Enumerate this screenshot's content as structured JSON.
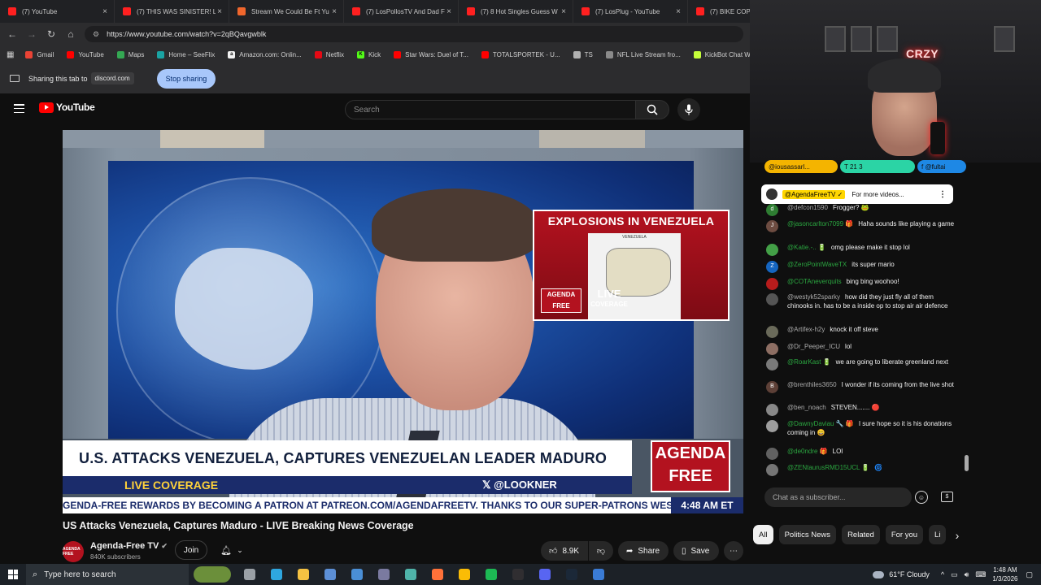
{
  "browser": {
    "tabs": [
      {
        "label": "(7) YouTube",
        "icon": "youtube-icon"
      },
      {
        "label": "(7) THIS WAS SINISTER! Lu",
        "icon": "youtube-icon"
      },
      {
        "label": "Stream We Could Be Ft Yu",
        "icon": "orange-site-icon"
      },
      {
        "label": "(7) LosPollosTV And Dad F",
        "icon": "youtube-icon"
      },
      {
        "label": "(7) 8 Hot Singles Guess W",
        "icon": "youtube-icon"
      },
      {
        "label": "(7) LosPlug - YouTube",
        "icon": "youtube-icon"
      },
      {
        "label": "(7) BIKE COPS",
        "icon": "youtube-icon"
      }
    ],
    "close_glyph": "×",
    "url": "https://www.youtube.com/watch?v=2qBQavgwblk",
    "bookmarks": [
      {
        "label": "Gmail",
        "color": "#ea4335",
        "glyph": ""
      },
      {
        "label": "YouTube",
        "color": "#ff0000",
        "glyph": ""
      },
      {
        "label": "Maps",
        "color": "#34a853",
        "glyph": ""
      },
      {
        "label": "Home – SeeFlix",
        "color": "#1aa3a3",
        "glyph": ""
      },
      {
        "label": "Amazon.com: Onlin...",
        "color": "#f2f2f2",
        "glyph": "a"
      },
      {
        "label": "Netflix",
        "color": "#e50914",
        "glyph": ""
      },
      {
        "label": "Kick",
        "color": "#53fc18",
        "glyph": "K"
      },
      {
        "label": "Star Wars: Duel of T...",
        "color": "#ff0000",
        "glyph": ""
      },
      {
        "label": "TOTALSPORTEK - U...",
        "color": "#ff0000",
        "glyph": ""
      },
      {
        "label": "TS",
        "color": "#b0b0b0",
        "glyph": ""
      },
      {
        "label": "NFL Live Stream fro...",
        "color": "#8a8a8a",
        "glyph": ""
      },
      {
        "label": "KickBot Chat Widget",
        "color": "#c6ff3a",
        "glyph": ""
      },
      {
        "label": "The be",
        "color": "#dddddd",
        "glyph": ""
      }
    ],
    "share_bar": {
      "text": "Sharing this tab to",
      "domain": "discord.com",
      "stop_label": "Stop sharing"
    }
  },
  "youtube": {
    "logo_text": "YouTube",
    "search_placeholder": "Search",
    "video": {
      "explosion_title": "EXPLOSIONS IN VENEZUELA",
      "map_title": "VENEZUELA",
      "mini_logo": "AGENDA FREE",
      "mini_live": "LIVE",
      "mini_coverage": "COVERAGE",
      "headline": "U.S. ATTACKS VENEZUELA, CAPTURES VENEZUELAN LEADER MADURO",
      "live_coverage": "LIVE COVERAGE",
      "handle": "𝕏 @LOOKNER",
      "logo_line1": "AGENDA",
      "logo_line2": "FREE",
      "ticker": "GENDA-FREE REWARDS BY BECOMING A PATRON AT PATREON.COM/AGENDAFREETV. THANKS TO OUR SUPER-PATRONS WESTON",
      "ticker_time": "4:48 AM ET"
    },
    "title": "US Attacks Venezuela, Captures Maduro - LIVE Breaking News Coverage",
    "channel": {
      "name": "Agenda-Free TV",
      "subs": "840K subscribers",
      "avatar_text": "AGENDA FREE"
    },
    "join_label": "Join",
    "likes": "8.9K",
    "share_label": "Share",
    "save_label": "Save"
  },
  "webcam": {
    "sign": "CRZY"
  },
  "chat": {
    "pins": [
      {
        "label": "@iousassarl...",
        "color": "#f4b400"
      },
      {
        "label": "T 21  3",
        "color": "#2bd4a5"
      },
      {
        "label": "f @fultai",
        "color": "#1e88e5"
      }
    ],
    "pinned": {
      "name": "@AgendaFreeTV ✓",
      "text": "For more videos..."
    },
    "messages": [
      {
        "user": "@defcon1590",
        "text": "Frogger? 🐸",
        "avatar": "d",
        "color": "#2e7d32",
        "member": false
      },
      {
        "user": "@jasoncarlton7099 🎁",
        "text": "Haha sounds like playing a game",
        "avatar": "J",
        "color": "#6d4c41",
        "member": true
      },
      {
        "user": "@Katie.-.. 🔋",
        "text": "omg please make it stop lol",
        "avatar": "",
        "color": "#43a047",
        "member": true
      },
      {
        "user": "@ZeroPointWaveTX",
        "text": "its super mario",
        "avatar": "Z",
        "color": "#1565c0",
        "member": true
      },
      {
        "user": "@COTAneverquits",
        "text": "bing bing woohoo!",
        "avatar": "",
        "color": "#b71c1c",
        "member": true
      },
      {
        "user": "@westyk52sparky",
        "text": "how did they just fly all of them chinooks in. has to be a inside op to stop air air defence",
        "avatar": "",
        "color": "#555555",
        "member": false
      },
      {
        "user": "@Artifex-h2y",
        "text": "knock it off steve",
        "avatar": "",
        "color": "#6a6a5a",
        "member": false
      },
      {
        "user": "@Dr_Peeper_ICU",
        "text": "lol",
        "avatar": "",
        "color": "#8d6e63",
        "member": false
      },
      {
        "user": "@RoarKast 🔋",
        "text": "we are going to liberate greenland next",
        "avatar": "",
        "color": "#7a7a7a",
        "member": true
      },
      {
        "user": "@brenthiles3650",
        "text": "I wonder if its coming from the live shot",
        "avatar": "B",
        "color": "#5d4037",
        "member": false
      },
      {
        "user": "@ben_noach",
        "text": "STEVEN....... 🔴",
        "avatar": "",
        "color": "#888888",
        "member": false
      },
      {
        "user": "@DawnyDaviau 🔧 🎁",
        "text": "I sure hope so it is his donations coming in 😀",
        "avatar": "",
        "color": "#9e9e9e",
        "member": true
      },
      {
        "user": "@de0ndre 🎁",
        "text": "LOl",
        "avatar": "",
        "color": "#616161",
        "member": true
      },
      {
        "user": "@ZENtaurusRMD15UCL 🔋",
        "text": "🌀",
        "avatar": "",
        "color": "#757575",
        "member": true
      }
    ],
    "input_placeholder": "Chat as a subscriber...",
    "chips": [
      "All",
      "Politics News",
      "Related",
      "For you",
      "Li"
    ]
  },
  "taskbar": {
    "search_text": "Type here to search",
    "apps": [
      {
        "name": "hamster-icon",
        "color": "#6b8f3a"
      },
      {
        "name": "task-view-icon",
        "color": "#9aa0a6"
      },
      {
        "name": "edge-icon",
        "color": "#2ea7e0"
      },
      {
        "name": "file-explorer-icon",
        "color": "#f5c242"
      },
      {
        "name": "app-icon-1",
        "color": "#5c8fd6"
      },
      {
        "name": "calculator-icon",
        "color": "#4a8fd6"
      },
      {
        "name": "app-icon-2",
        "color": "#7a7aa0"
      },
      {
        "name": "app-icon-3",
        "color": "#4fb3a9"
      },
      {
        "name": "firefox-icon",
        "color": "#ff7139"
      },
      {
        "name": "chrome-icon",
        "color": "#fbbc05"
      },
      {
        "name": "spotify-icon",
        "color": "#1db954"
      },
      {
        "name": "obs-icon",
        "color": "#302e31"
      },
      {
        "name": "discord-icon",
        "color": "#5865f2"
      },
      {
        "name": "steam-icon",
        "color": "#1b2838"
      },
      {
        "name": "app-icon-4",
        "color": "#3a7bd5"
      }
    ],
    "weather": "61°F  Cloudy",
    "time": "1:48 AM",
    "date": "1/3/2026"
  }
}
